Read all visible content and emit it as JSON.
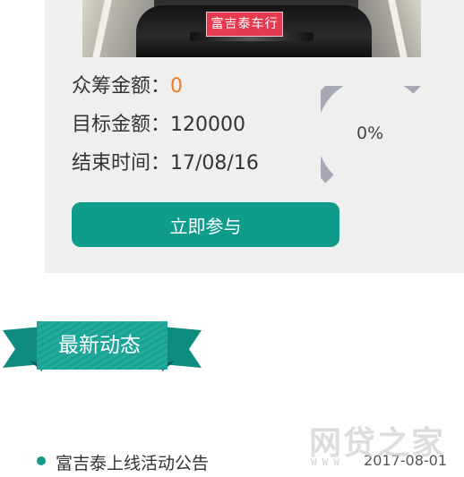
{
  "campaign": {
    "plate_text": "富吉泰车行",
    "raised_label": "众筹金额：",
    "raised_value": "0",
    "target_label": "目标金额：",
    "target_value": "120000",
    "end_label": "结束时间：",
    "end_value": "17/08/16",
    "progress_percent_text": "0%",
    "progress_fraction": 0,
    "join_button_label": "立即参与",
    "colors": {
      "accent": "#109c8a",
      "highlight": "#f07a1e",
      "ring": "#a6a8b6"
    }
  },
  "news": {
    "section_title": "最新动态",
    "items": [
      {
        "title": "富吉泰上线活动公告",
        "date": "2017-08-01"
      }
    ]
  },
  "watermark": {
    "text": "网贷之家",
    "url": "WWW"
  }
}
